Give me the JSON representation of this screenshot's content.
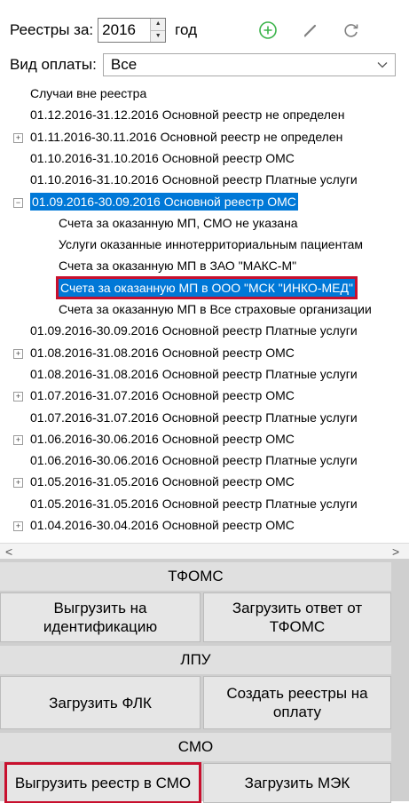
{
  "header": {
    "registers_label": "Реестры за:",
    "year": "2016",
    "year_suffix": "год",
    "payment_label": "Вид оплаты:",
    "payment_value": "Все",
    "icons": [
      "add-circle-icon",
      "pencil-icon",
      "refresh-icon"
    ],
    "accent_color": "#3cb44b"
  },
  "tree": [
    {
      "text": "Случаи вне реестра"
    },
    {
      "text": "01.12.2016-31.12.2016 Основной реестр не определен"
    },
    {
      "text": "01.11.2016-30.11.2016 Основной реестр не определен",
      "expand": "+"
    },
    {
      "text": "01.10.2016-31.10.2016 Основной реестр ОМС"
    },
    {
      "text": "01.10.2016-31.10.2016 Основной реестр Платные услуги"
    },
    {
      "text": "01.09.2016-30.09.2016 Основной реестр ОМС",
      "expand": "−",
      "selected": true
    },
    {
      "text": "Счета за оказанную МП, СМО не указана",
      "child": true
    },
    {
      "text": "Услуги оказанные иннотерриториальным пациентам",
      "child": true
    },
    {
      "text": "Счета за оказанную МП в ЗАО \"МАКС-М\"",
      "child": true
    },
    {
      "text": "Счета за оказанную МП в ООО \"МСК \"ИНКО-МЕД\"",
      "child": true,
      "highlighted": true
    },
    {
      "text": "Счета за оказанную МП в Все страховые организации",
      "child": true
    },
    {
      "text": "01.09.2016-30.09.2016 Основной реестр Платные услуги"
    },
    {
      "text": "01.08.2016-31.08.2016 Основной реестр ОМС",
      "expand": "+"
    },
    {
      "text": "01.08.2016-31.08.2016 Основной реестр Платные услуги"
    },
    {
      "text": "01.07.2016-31.07.2016 Основной реестр ОМС",
      "expand": "+"
    },
    {
      "text": "01.07.2016-31.07.2016 Основной реестр Платные услуги"
    },
    {
      "text": "01.06.2016-30.06.2016 Основной реестр ОМС",
      "expand": "+"
    },
    {
      "text": "01.06.2016-30.06.2016 Основной реестр Платные услуги"
    },
    {
      "text": "01.05.2016-31.05.2016 Основной реестр ОМС",
      "expand": "+"
    },
    {
      "text": "01.05.2016-31.05.2016 Основной реестр Платные услуги"
    },
    {
      "text": "01.04.2016-30.04.2016 Основной реестр ОМС",
      "expand": "+"
    }
  ],
  "panel": {
    "tfoms": "ТФОМС",
    "btn_export_ident": "Выгрузить на идентификацию",
    "btn_load_tfoms": "Загрузить ответ от ТФОМС",
    "lpu": "ЛПУ",
    "btn_load_flk": "Загрузить ФЛК",
    "btn_create_registers": "Создать реестры на оплату",
    "smo": "СМО",
    "btn_export_smo": "Выгрузить реестр в СМО",
    "btn_load_mek": "Загрузить МЭК"
  },
  "highlight_color": "#c8102e",
  "selection_color": "#0078d7"
}
